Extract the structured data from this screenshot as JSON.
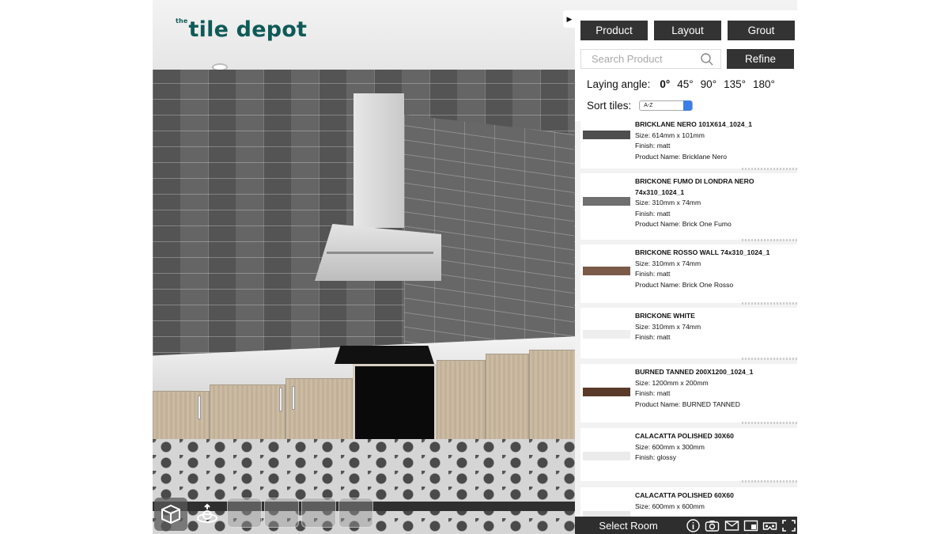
{
  "brand": {
    "logo_prefix": "the",
    "logo_text": "tile depot"
  },
  "tabs": [
    {
      "label": "Product"
    },
    {
      "label": "Layout"
    },
    {
      "label": "Grout"
    }
  ],
  "search": {
    "placeholder": "Search Product",
    "value": ""
  },
  "refine_label": "Refine",
  "laying_angle": {
    "label": "Laying angle:",
    "options": [
      "0°",
      "45°",
      "90°",
      "135°",
      "180°"
    ],
    "selected": "0°"
  },
  "sort": {
    "label": "Sort tiles:",
    "value": "A-Z"
  },
  "products": [
    {
      "name": "BRICKLANE NERO 101X614_1024_1",
      "size": "Size: 614mm x 101mm",
      "finish": "Finish: matt",
      "product_name": "Product Name: Bricklane Nero",
      "swatch": "#4e4e4e"
    },
    {
      "name": "BRICKONE FUMO DI LONDRA NERO 74x310_1024_1",
      "size": "Size: 310mm x 74mm",
      "finish": "Finish: matt",
      "product_name": "Product Name: Brick One Fumo",
      "swatch": "#6f6f6f"
    },
    {
      "name": "BRICKONE ROSSO WALL 74x310_1024_1",
      "size": "Size: 310mm x 74mm",
      "finish": "Finish: matt",
      "product_name": "Product Name: Brick One Rosso",
      "swatch": "#7a5a48"
    },
    {
      "name": "BRICKONE WHITE",
      "size": "Size: 310mm x 74mm",
      "finish": "Finish: matt",
      "product_name": "",
      "swatch": "#eeeeee"
    },
    {
      "name": "BURNED TANNED 200X1200_1024_1",
      "size": "Size: 1200mm x 200mm",
      "finish": "Finish: matt",
      "product_name": "Product Name: BURNED TANNED",
      "swatch": "#5a3a28"
    },
    {
      "name": "CALACATTA POLISHED 30X60",
      "size": "Size: 600mm x 300mm",
      "finish": "Finish: glossy",
      "product_name": "",
      "swatch": "#ebebeb"
    },
    {
      "name": "CALACATTA POLISHED 60X60",
      "size": "Size: 600mm x 600mm",
      "finish": "",
      "product_name": "",
      "swatch": "#e8e8e8"
    }
  ],
  "bottom_bar": {
    "select_room_label": "Select Room",
    "icons": [
      "info-icon",
      "camera-icon",
      "mail-icon",
      "layout-icon",
      "vr-icon",
      "fullscreen-icon"
    ]
  }
}
